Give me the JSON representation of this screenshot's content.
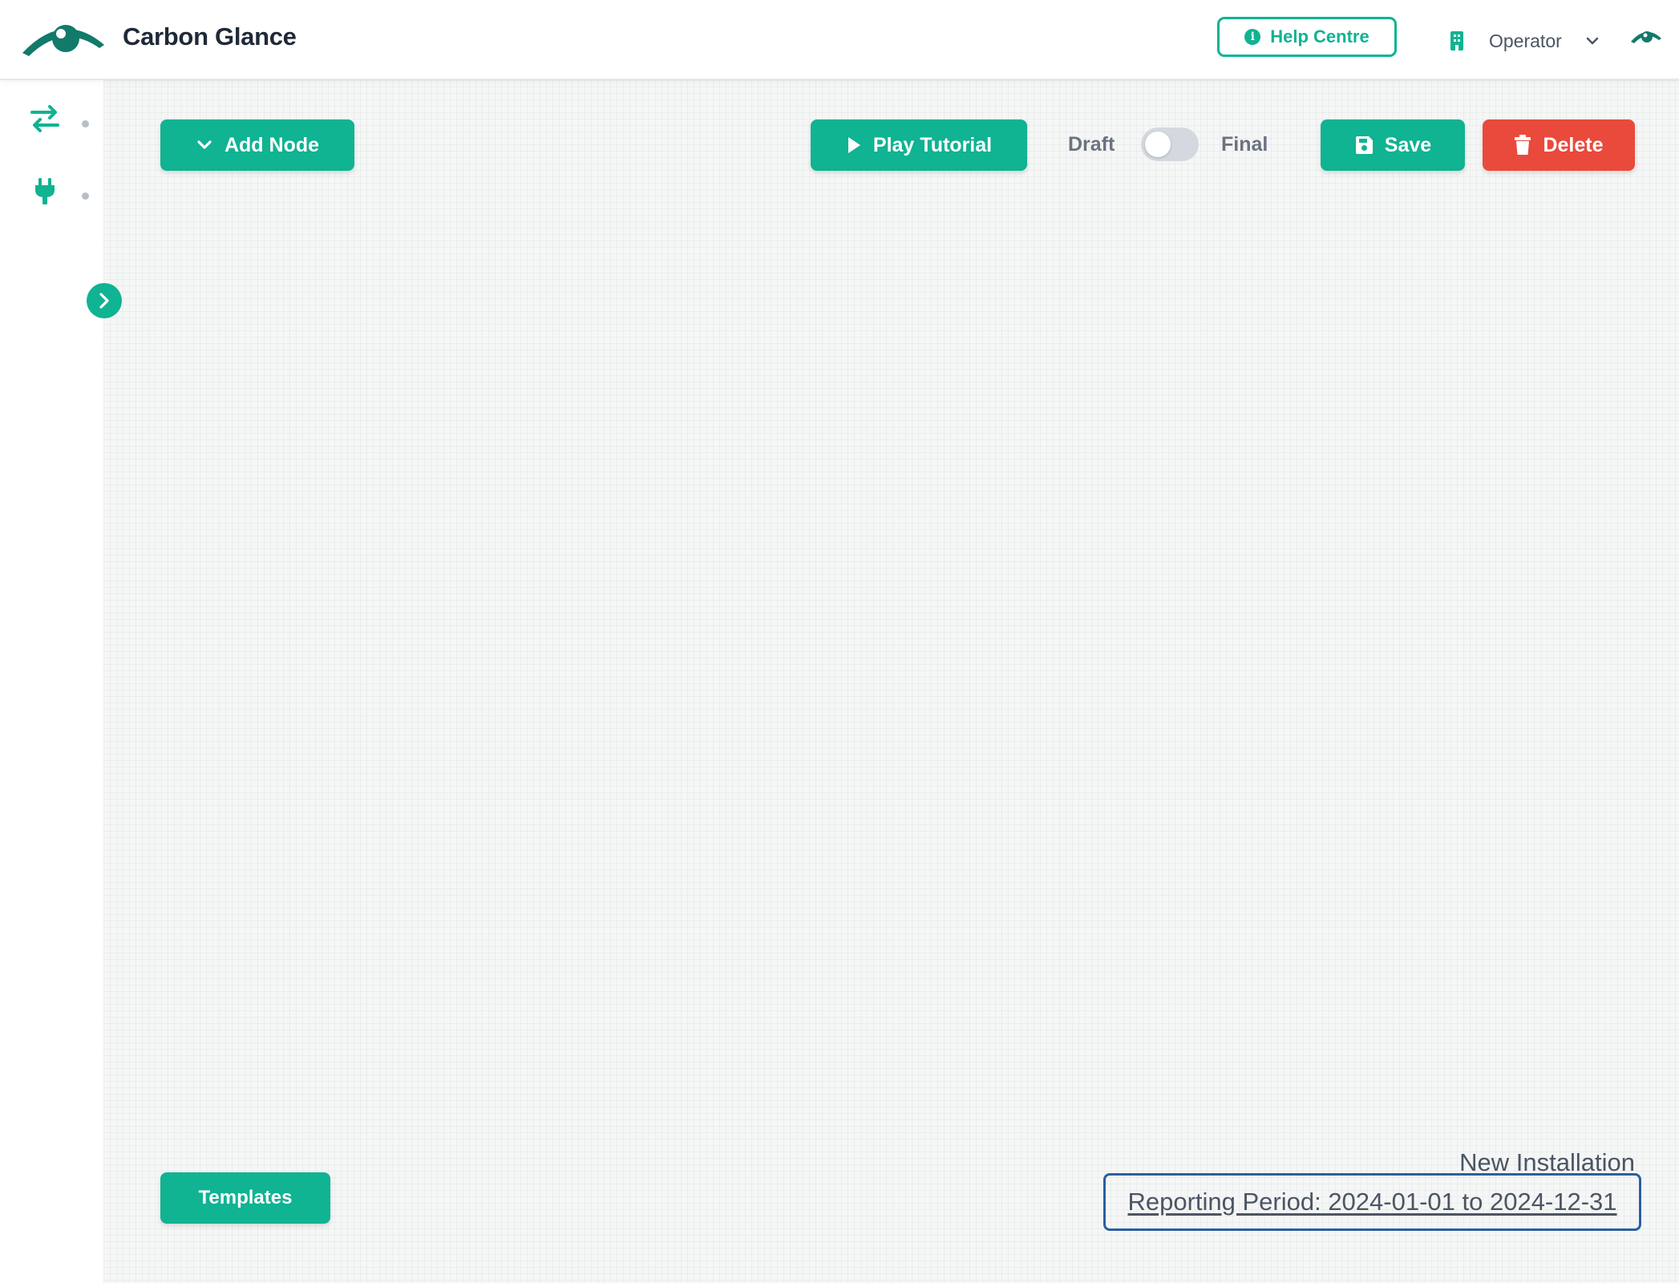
{
  "header": {
    "app_title": "Carbon Glance",
    "help_label": "Help Centre",
    "role_label": "Operator"
  },
  "toolbar": {
    "add_node_label": "Add Node",
    "play_tutorial_label": "Play Tutorial",
    "draft_label": "Draft",
    "final_label": "Final",
    "toggle_state": "draft",
    "save_label": "Save",
    "delete_label": "Delete"
  },
  "sidebar": {
    "items": [
      {
        "icon": "arrows-exchange-icon"
      },
      {
        "icon": "plug-icon"
      }
    ]
  },
  "footer": {
    "templates_label": "Templates",
    "installation_name": "New Installation",
    "reporting_period": "Reporting Period: 2024-01-01 to 2024-12-31"
  },
  "colors": {
    "brand": "#10b392",
    "danger": "#e94a3c",
    "logo": "#127a6a",
    "focus_border": "#2c5fa0"
  }
}
